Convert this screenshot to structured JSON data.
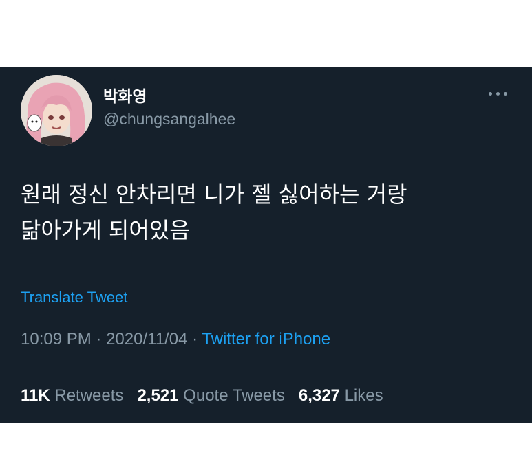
{
  "tweet": {
    "display_name": "박화영",
    "handle": "@chungsangalhee",
    "text_line1": "원래 정신 안차리면 니가 젤 싫어하는 거랑",
    "text_line2": "닮아가게 되어있음",
    "translate_label": "Translate Tweet",
    "time": "10:09 PM",
    "separator": "·",
    "date": "2020/11/04",
    "source": "Twitter for iPhone",
    "retweets_count": "11K",
    "retweets_label": "Retweets",
    "quotes_count": "2,521",
    "quotes_label": "Quote Tweets",
    "likes_count": "6,327",
    "likes_label": "Likes"
  },
  "icons": {
    "more": "more-horizontal-icon"
  },
  "colors": {
    "background": "#15202b",
    "secondary_text": "#8899a6",
    "accent": "#1da1f2",
    "divider": "#38444d"
  }
}
